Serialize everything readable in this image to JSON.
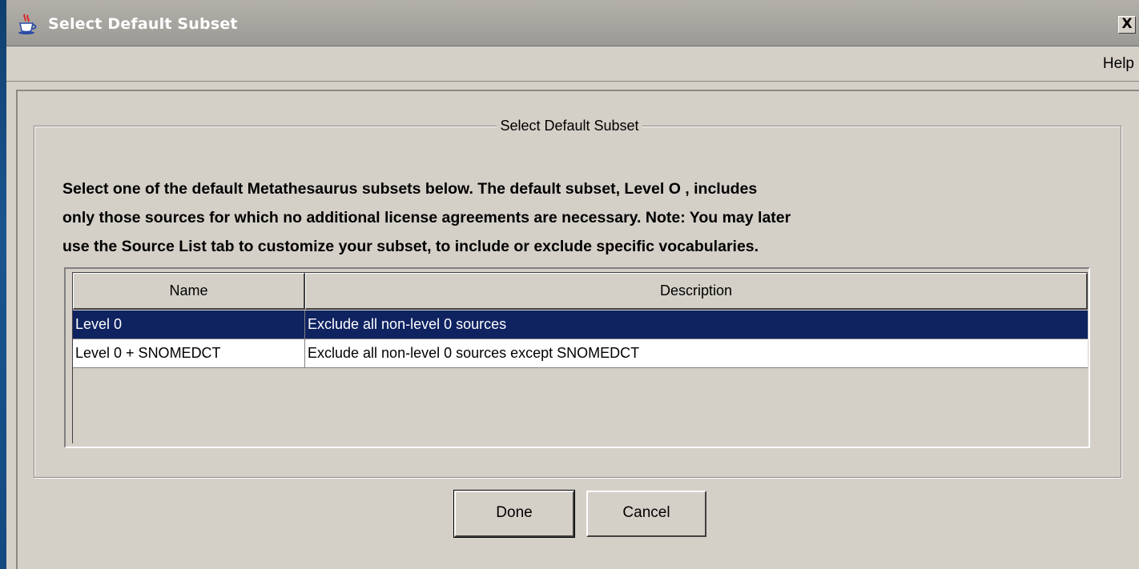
{
  "window": {
    "title": "Select Default Subset",
    "close_symbol": "X"
  },
  "menubar": {
    "help_label": "Help"
  },
  "group": {
    "title": "Select Default Subset",
    "instructions": [
      "Select one of the default Metathesaurus subsets below. The default subset, Level O , includes",
      "only those sources for which no additional license agreements are necessary. Note:  You may later",
      "use the Source List tab to customize your subset, to include or exclude specific vocabularies."
    ]
  },
  "table": {
    "columns": [
      "Name",
      "Description"
    ],
    "rows": [
      {
        "name": "Level 0",
        "description": "Exclude all non-level 0 sources",
        "selected": true
      },
      {
        "name": "Level 0 + SNOMEDCT",
        "description": "Exclude all non-level 0 sources except SNOMEDCT",
        "selected": false
      }
    ]
  },
  "buttons": {
    "done_label": "Done",
    "cancel_label": "Cancel"
  },
  "colors": {
    "selection": "#0f2361",
    "dialog_bg": "#d4d0c8",
    "desktop_bg": "#1a5590"
  },
  "icons": {
    "app_icon": "java-cup-icon",
    "close_icon": "close-icon"
  }
}
